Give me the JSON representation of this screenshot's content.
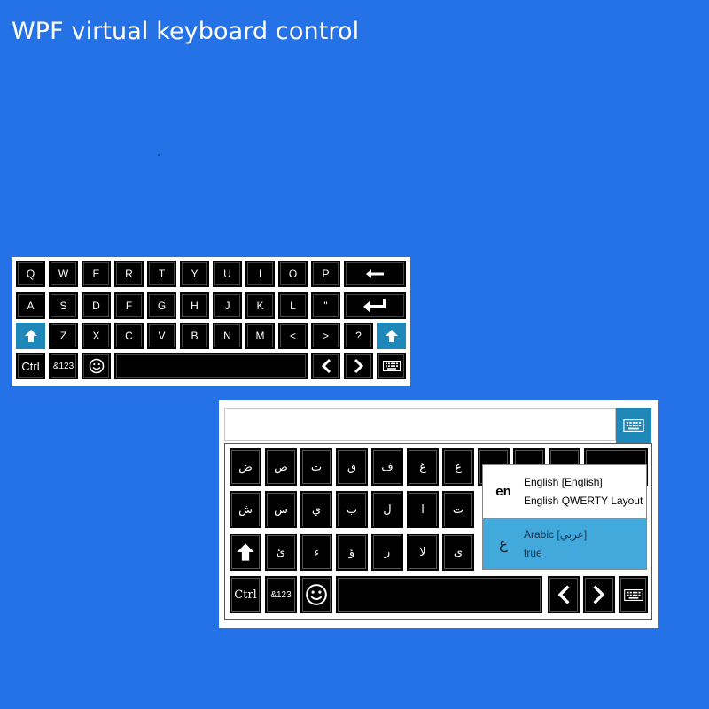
{
  "title": "WPF virtual keyboard control",
  "keyboard1": {
    "row1": [
      "Q",
      "W",
      "E",
      "R",
      "T",
      "Y",
      "U",
      "I",
      "O",
      "P"
    ],
    "row2": [
      "A",
      "S",
      "D",
      "F",
      "G",
      "H",
      "J",
      "K",
      "L",
      "\""
    ],
    "row3": [
      "Z",
      "X",
      "C",
      "V",
      "B",
      "N",
      "M",
      "<",
      ">",
      "?"
    ],
    "ctrl_label": "Ctrl",
    "symbols_label": "&123",
    "icons": {
      "backspace": "left-arrow-icon",
      "enter": "enter-icon",
      "shift": "shift-up-icon",
      "emoji": "smiley-icon",
      "prev": "chevron-left-icon",
      "next": "chevron-right-icon",
      "keyboard": "keyboard-icon"
    },
    "accent_color": "#1f88b8"
  },
  "keyboard2": {
    "textbox_value": "",
    "row1": [
      "ض",
      "ص",
      "ث",
      "ق",
      "ف",
      "غ",
      "ع"
    ],
    "row2": [
      "ش",
      "س",
      "ي",
      "ب",
      "ل",
      "ا",
      "ت"
    ],
    "row3": [
      "ئ",
      "ء",
      "ؤ",
      "ر",
      "لا",
      "ى"
    ],
    "ctrl_label": "Ctrl",
    "symbols_label": "&123",
    "language_popup": {
      "items": [
        {
          "code": "en",
          "name": "English [English]",
          "layout": "English QWERTY Layout",
          "selected": false
        },
        {
          "code": "ع",
          "name": "Arabic [عربي]",
          "layout": "true",
          "selected": true
        }
      ]
    }
  },
  "colors": {
    "background": "#2572e6",
    "key": "#000000",
    "accent": "#1f88b8",
    "selected": "#41a9dc"
  }
}
